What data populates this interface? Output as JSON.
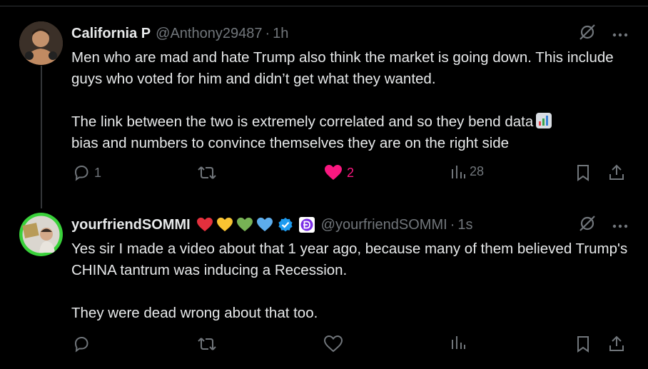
{
  "tweets": [
    {
      "display_name": "California P",
      "handle": "@Anthony29487",
      "separator": "·",
      "time": "1h",
      "text_lines": [
        "Men who are mad and hate Trump also think the market is going down. This include guys who voted for him and didn’t get what they wanted.",
        "The link between the two is extremely correlated and so they bend data",
        "bias and numbers to convince themselves they are on the right side"
      ],
      "emoji": "bar-chart-emoji",
      "replies": "1",
      "retweets": "",
      "likes": "2",
      "views": "28",
      "liked": true
    },
    {
      "display_name": "yourfriendSOMMI",
      "handle": "@yourfriendSOMMI",
      "separator": "·",
      "time": "1s",
      "name_emojis": [
        "red-heart",
        "yellow-heart",
        "green-heart",
        "blue-heart"
      ],
      "verified": true,
      "text_lines": [
        "Yes sir I made a video about that 1 year ago, because many of them believed Trump's CHINA tantrum was inducing a Recession.",
        "They were dead wrong about that too."
      ],
      "replies": "",
      "retweets": "",
      "likes": "",
      "views": "",
      "liked": false
    }
  ],
  "colors": {
    "background": "#000000",
    "text": "#e7e9ea",
    "muted": "#71767b",
    "like": "#f91880",
    "verified": "#1d9bf0"
  }
}
